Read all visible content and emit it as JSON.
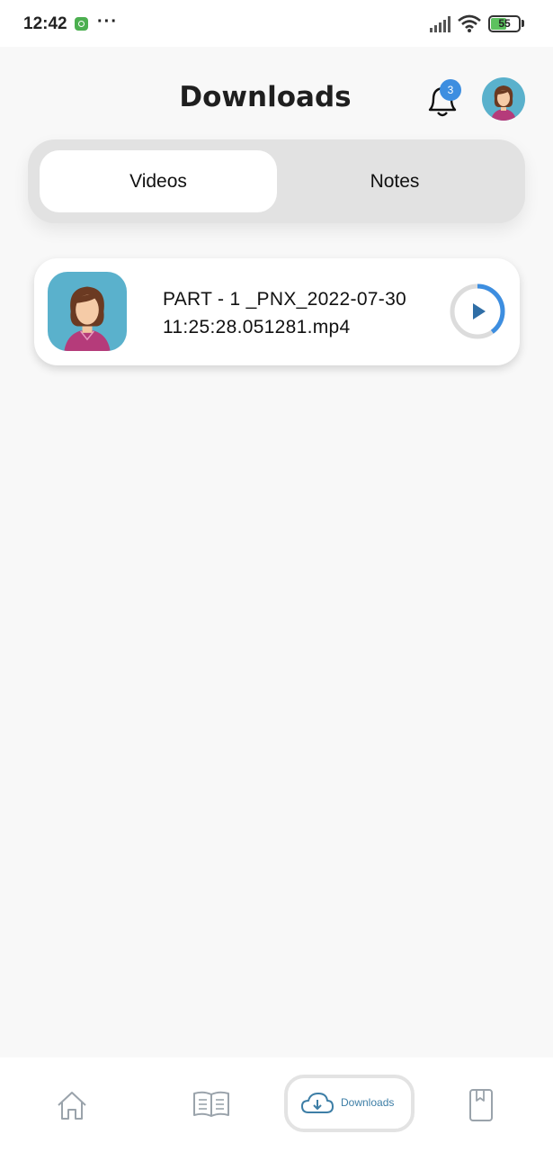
{
  "status_bar": {
    "time": "12:42",
    "dots": "···",
    "battery_level": "55",
    "battery_fraction": 0.55
  },
  "header": {
    "title": "Downloads",
    "notification_count": "3"
  },
  "tabs": [
    {
      "label": "Videos",
      "selected": true
    },
    {
      "label": "Notes",
      "selected": false
    }
  ],
  "downloads": [
    {
      "file_name_line1": "PART - 1 _PNX_2022-07-30",
      "file_name_line2": "11:25:28.051281.mp4",
      "progress": 0.4
    }
  ],
  "bottom_nav": {
    "items": [
      {
        "icon": "home-icon"
      },
      {
        "icon": "book-icon"
      },
      {
        "icon": "cloud-download-icon",
        "label": "Downloads",
        "active": true
      },
      {
        "icon": "bookmark-icon"
      }
    ]
  },
  "colors": {
    "accent": "#3d8ee0",
    "nav_active": "#3d7ea6",
    "avatar_bg": "#5ab1cc",
    "page_bg": "#f8f8f8"
  }
}
